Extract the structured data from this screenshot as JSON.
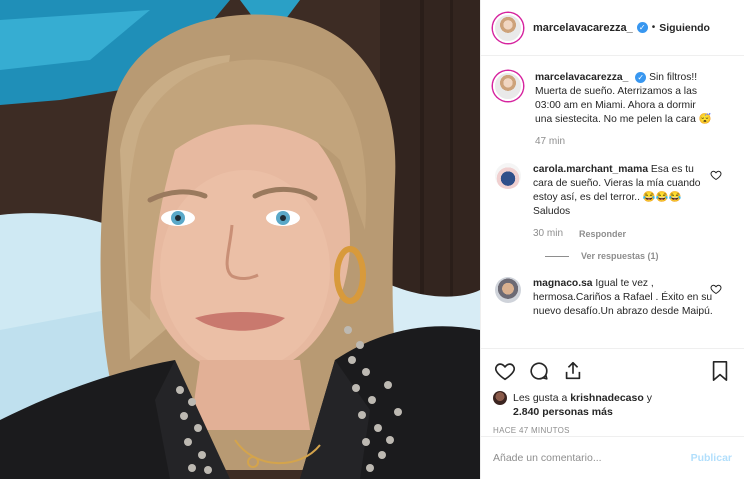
{
  "post": {
    "image_alt": "Selfie de mujer rubia con chaqueta con tachas",
    "author": "marcelavacarezza_",
    "follow_state": "Siguiendo",
    "separator": "•"
  },
  "caption": {
    "user": "marcelavacarezza_",
    "text": "Sin filtros!! Muerta de sueño. Aterrizamos a las 03:00 am en Miami. Ahora a dormir una siestecita. No me pelen la cara 😴",
    "time": "47 min"
  },
  "comments": [
    {
      "user": "carola.marchant_mama",
      "text": "Esa es tu cara de sueño. Vieras la mía cuando estoy así, es del terror.. 😂😂😂 Saludos",
      "time": "30 min",
      "reply_label": "Responder",
      "view_replies": "Ver respuestas (1)"
    },
    {
      "user": "magnaco.sa",
      "text": "Igual te vez , hermosa.Cariños a Rafael . Éxito en su nuevo desafío.Un abrazo desde Maipú."
    }
  ],
  "likes": {
    "prefix": "Les gusta a",
    "user": "krishnadecaso",
    "connector": "y",
    "others": "2.840 personas más"
  },
  "timeago": "HACE 47 MINUTOS",
  "comment_input": {
    "placeholder": "Añade un comentario...",
    "publish_label": "Publicar"
  },
  "icons": {
    "verified": "verified-badge-icon",
    "like": "heart-icon",
    "comment": "comment-icon",
    "share": "share-icon",
    "save": "bookmark-icon"
  },
  "colors": {
    "verified": "#3897f0",
    "muted": "#8e8e8e",
    "publish_disabled": "#b2dffc"
  }
}
